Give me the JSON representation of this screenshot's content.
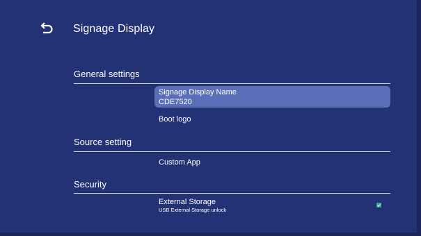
{
  "header": {
    "title": "Signage Display",
    "back_icon": "back-arrow-icon"
  },
  "sections": {
    "general": {
      "title": "General settings",
      "items": [
        {
          "label": "Signage Display Name",
          "value": "CDE7520"
        },
        {
          "label": "Boot logo"
        }
      ]
    },
    "source": {
      "title": "Source setting",
      "items": [
        {
          "label": "Custom App"
        }
      ]
    },
    "security": {
      "title": "Security",
      "items": [
        {
          "label": "External Storage",
          "description": "USB External Storage unlock",
          "checked": true
        }
      ]
    }
  },
  "colors": {
    "background": "#233275",
    "selected_item": "#5b6fb8",
    "checkbox": "#2fa38c"
  }
}
